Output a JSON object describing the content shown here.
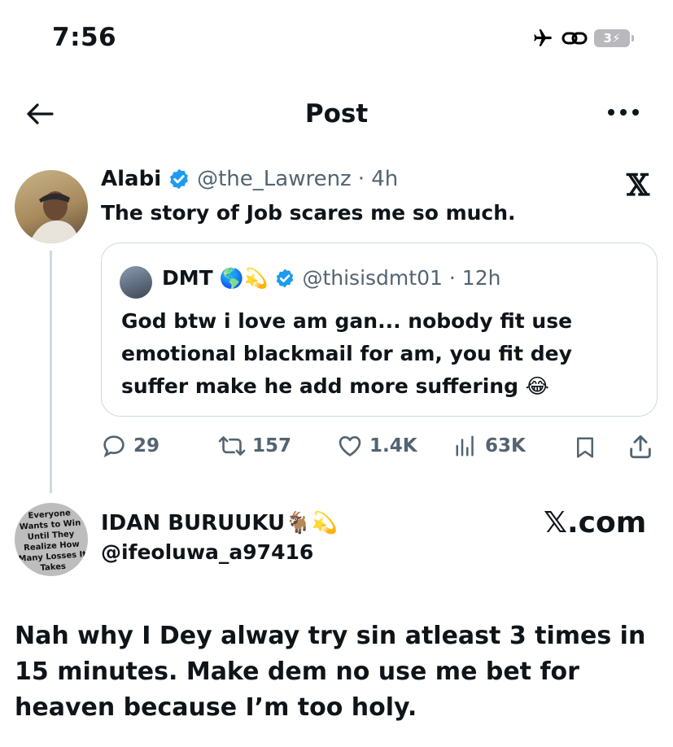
{
  "status_bar": {
    "time": "7:56",
    "battery": "3"
  },
  "header": {
    "title": "Post"
  },
  "tweet": {
    "name": "Alabi",
    "handle": "@the_Lawrenz",
    "time": "· 4h",
    "text": "The story of Job scares me so much.",
    "logo": "𝕏"
  },
  "quote": {
    "name": "DMT",
    "emojis": "🌎💫",
    "handle": "@thisisdmt01",
    "time": "· 12h",
    "text": "God btw i love am gan... nobody fit use emotional blackmail for am, you fit dey suffer make he add more suffering 😂"
  },
  "actions": {
    "replies": "29",
    "reposts": "157",
    "likes": "1.4K",
    "views": "63K"
  },
  "user2": {
    "name": "IDAN BURUUKU🐐💫",
    "handle": "@ifeoluwa_a97416",
    "avatar_text": "Everyone Wants to Win Until They Realize How Many Losses It Takes",
    "brand": "𝕏.com"
  },
  "body": {
    "text": "Nah why I Dey alway try sin atleast 3 times in 15 minutes. Make dem no use me bet for heaven because I’m too holy."
  },
  "colors": {
    "accent": "#1d9bf0",
    "muted": "#536471",
    "border": "#cfd9de"
  }
}
